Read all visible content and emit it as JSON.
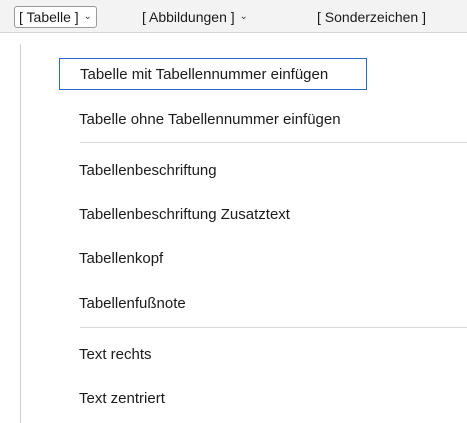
{
  "toolbar": {
    "items": [
      {
        "label": "[ Tabelle ]",
        "chevron": "⌄"
      },
      {
        "label": "[ Abbildungen ]",
        "chevron": "⌄"
      },
      {
        "label": "[ Sonderzeichen ]"
      }
    ]
  },
  "menu": {
    "items": [
      {
        "label": "Tabelle mit Tabellennummer einfügen"
      },
      {
        "label": "Tabelle ohne Tabellennummer einfügen"
      },
      {
        "label": "Tabellenbeschriftung"
      },
      {
        "label": "Tabellenbeschriftung Zusatztext"
      },
      {
        "label": "Tabellenkopf"
      },
      {
        "label": "Tabellenfußnote"
      },
      {
        "label": "Text rechts"
      },
      {
        "label": "Text zentriert"
      }
    ]
  }
}
